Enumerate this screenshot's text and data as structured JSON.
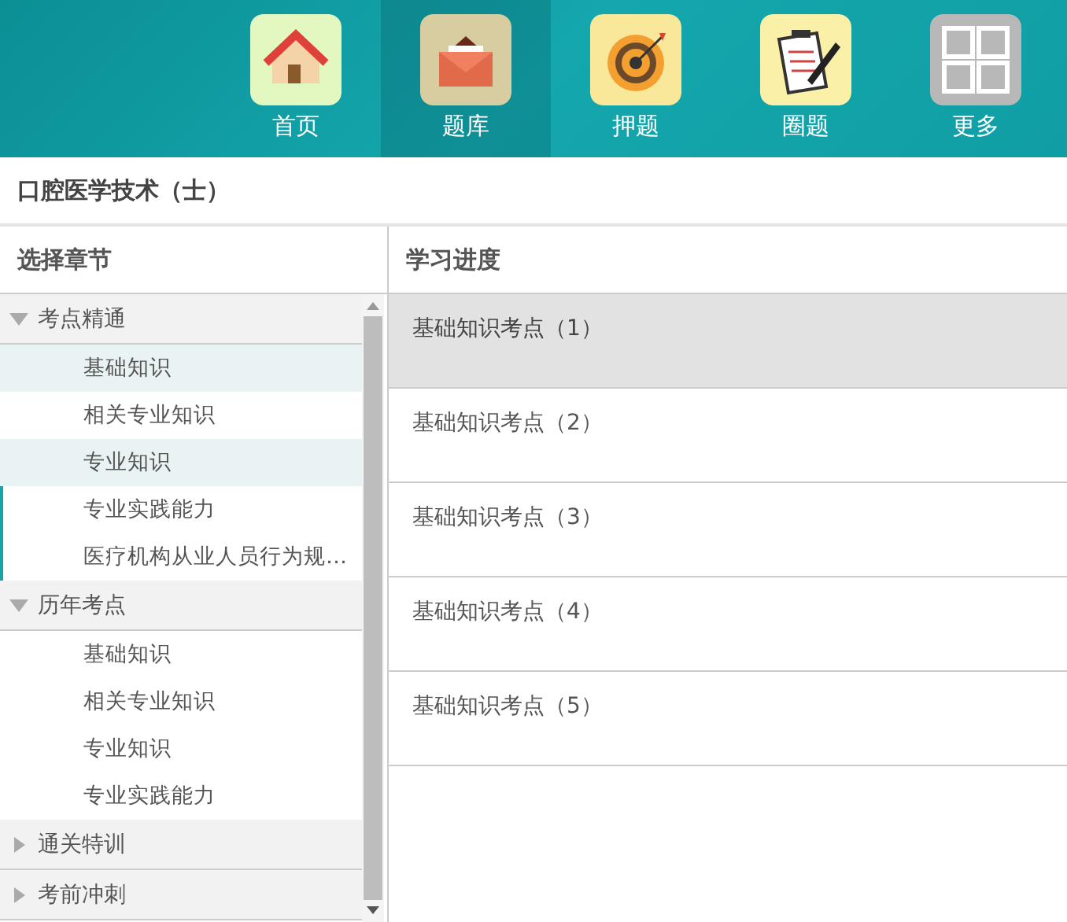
{
  "nav": [
    {
      "label": "首页",
      "kind": "home",
      "selected": false
    },
    {
      "label": "题库",
      "kind": "mail",
      "selected": true
    },
    {
      "label": "押题",
      "kind": "target",
      "selected": false
    },
    {
      "label": "圈题",
      "kind": "clipboard",
      "selected": false
    },
    {
      "label": "更多",
      "kind": "grid",
      "selected": false
    }
  ],
  "title": "口腔医学技术（士）",
  "sidebar": {
    "heading": "选择章节",
    "groups": [
      {
        "label": "考点精通",
        "expanded": true,
        "children": [
          {
            "label": "基础知识",
            "highlighted": true,
            "accent": false
          },
          {
            "label": "相关专业知识",
            "highlighted": false,
            "accent": false
          },
          {
            "label": "专业知识",
            "highlighted": true,
            "accent": false
          },
          {
            "label": "专业实践能力",
            "highlighted": false,
            "accent": true
          },
          {
            "label": "医疗机构从业人员行为规…",
            "highlighted": false,
            "accent": true
          }
        ]
      },
      {
        "label": "历年考点",
        "expanded": true,
        "children": [
          {
            "label": "基础知识",
            "highlighted": false,
            "accent": false
          },
          {
            "label": "相关专业知识",
            "highlighted": false,
            "accent": false
          },
          {
            "label": "专业知识",
            "highlighted": false,
            "accent": false
          },
          {
            "label": "专业实践能力",
            "highlighted": false,
            "accent": false
          }
        ]
      },
      {
        "label": "通关特训",
        "expanded": false
      },
      {
        "label": "考前冲刺",
        "expanded": false
      }
    ]
  },
  "progress": {
    "heading": "学习进度",
    "items": [
      {
        "label": "基础知识考点（1）",
        "selected": true
      },
      {
        "label": "基础知识考点（2）",
        "selected": false
      },
      {
        "label": "基础知识考点（3）",
        "selected": false
      },
      {
        "label": "基础知识考点（4）",
        "selected": false
      },
      {
        "label": "基础知识考点（5）",
        "selected": false
      }
    ]
  }
}
